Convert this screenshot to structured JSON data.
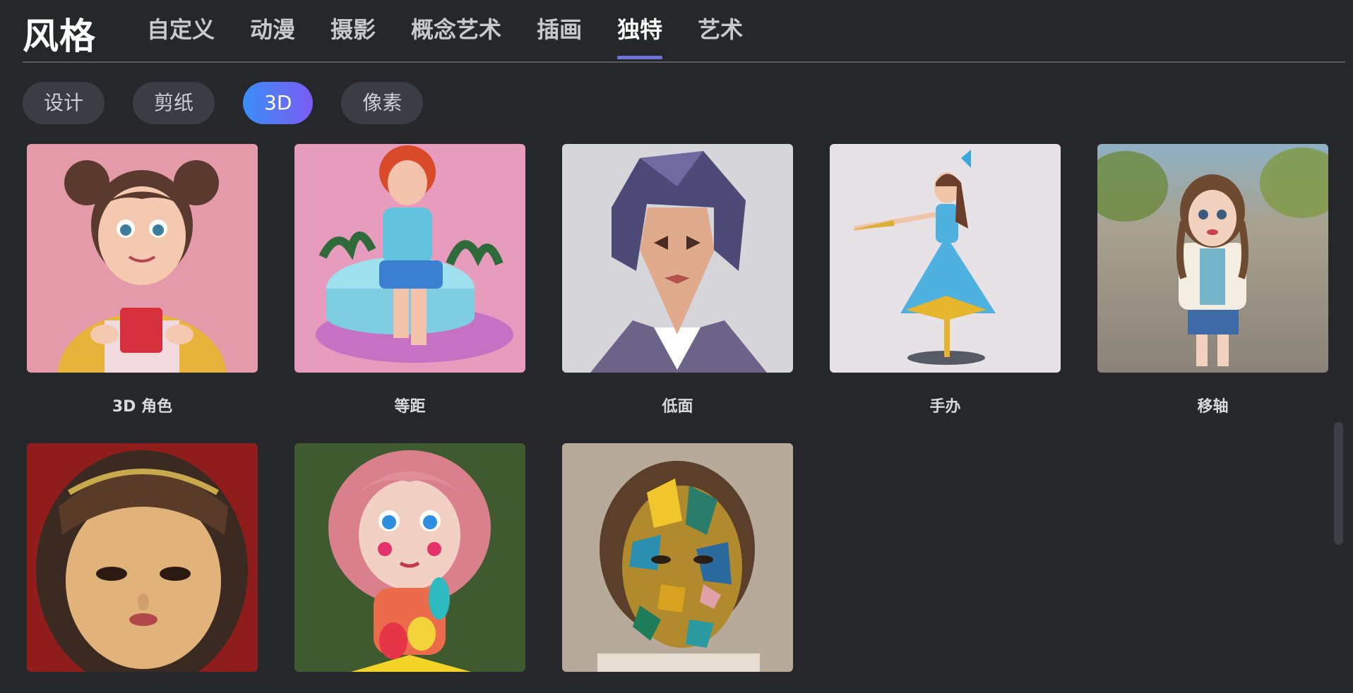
{
  "header": {
    "title": "风格",
    "tabs": [
      {
        "label": "自定义"
      },
      {
        "label": "动漫"
      },
      {
        "label": "摄影"
      },
      {
        "label": "概念艺术"
      },
      {
        "label": "插画"
      },
      {
        "label": "独特",
        "active": true
      },
      {
        "label": "艺术"
      }
    ]
  },
  "subcategories": [
    {
      "label": "设计"
    },
    {
      "label": "剪纸"
    },
    {
      "label": "3D",
      "active": true
    },
    {
      "label": "像素"
    }
  ],
  "styles": [
    {
      "label": "3D 角色",
      "icon": "cartoon-girl-3d-thumbnail"
    },
    {
      "label": "等距",
      "icon": "isometric-girl-thumbnail"
    },
    {
      "label": "低面",
      "icon": "low-poly-portrait-thumbnail"
    },
    {
      "label": "手办",
      "icon": "figurine-thumbnail"
    },
    {
      "label": "移轴",
      "icon": "tilt-shift-doll-thumbnail"
    },
    {
      "label": "",
      "icon": "vintage-doll-thumbnail"
    },
    {
      "label": "",
      "icon": "clay-doll-thumbnail"
    },
    {
      "label": "",
      "icon": "mosaic-bust-thumbnail"
    }
  ],
  "colors": {
    "background": "#25272b",
    "active_tab_underline": "#6f74d8",
    "chip_bg": "#3a3d44",
    "chip_active_gradient": [
      "#3b8ef7",
      "#7a5cf3"
    ]
  }
}
